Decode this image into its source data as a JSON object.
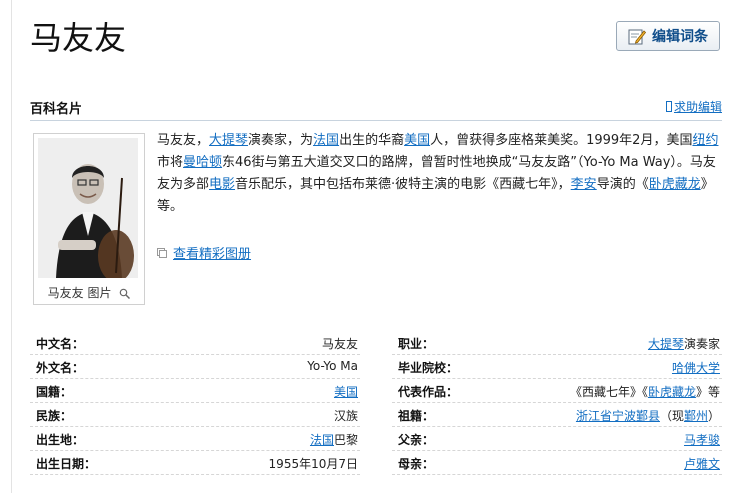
{
  "header": {
    "title": "马友友",
    "edit_button_label": "编辑词条"
  },
  "section": {
    "title": "百科名片",
    "help_edit": "求助编辑"
  },
  "card": {
    "photo_caption": "马友友 图片",
    "gallery_link": "查看精彩图册",
    "summary": [
      {
        "text": "马友友，"
      },
      {
        "text": "大提琴",
        "link": true
      },
      {
        "text": "演奏家，为"
      },
      {
        "text": "法国",
        "link": true
      },
      {
        "text": "出生的华裔"
      },
      {
        "text": "美国",
        "link": true
      },
      {
        "text": "人，曾获得多座格莱美奖。1999年2月，美国"
      },
      {
        "text": "纽约",
        "link": true
      },
      {
        "text": "市将"
      },
      {
        "text": "曼哈顿",
        "link": true
      },
      {
        "text": "东46街与第五大道交叉口的路牌，曾暂时性地换成“马友友路”（Yo-Yo Ma Way）。马友友为多部"
      },
      {
        "text": "电影",
        "link": true
      },
      {
        "text": "音乐配乐，其中包括布莱德·彼特主演的电影《西藏七年》，"
      },
      {
        "text": "李安",
        "link": true
      },
      {
        "text": "导演的《"
      },
      {
        "text": "卧虎藏龙",
        "link": true
      },
      {
        "text": "》等。"
      }
    ]
  },
  "info_left": [
    {
      "label": "中文名：",
      "parts": [
        {
          "text": "马友友"
        }
      ]
    },
    {
      "label": "外文名：",
      "parts": [
        {
          "text": "Yo-Yo Ma"
        }
      ]
    },
    {
      "label": "国籍：",
      "parts": [
        {
          "text": "美国",
          "link": true
        }
      ]
    },
    {
      "label": "民族：",
      "parts": [
        {
          "text": "汉族"
        }
      ]
    },
    {
      "label": "出生地：",
      "parts": [
        {
          "text": "法国",
          "link": true
        },
        {
          "text": "巴黎"
        }
      ]
    },
    {
      "label": "出生日期：",
      "parts": [
        {
          "text": "1955年10月7日"
        }
      ]
    }
  ],
  "info_right": [
    {
      "label": "职业：",
      "parts": [
        {
          "text": "大提琴",
          "link": true
        },
        {
          "text": "演奏家"
        }
      ]
    },
    {
      "label": "毕业院校：",
      "parts": [
        {
          "text": "哈佛大学",
          "link": true
        }
      ]
    },
    {
      "label": "代表作品：",
      "parts": [
        {
          "text": "《西藏七年》《"
        },
        {
          "text": "卧虎藏龙",
          "link": true
        },
        {
          "text": "》等"
        }
      ]
    },
    {
      "label": "祖籍：",
      "parts": [
        {
          "text": "浙江省宁波鄞县",
          "link": true
        },
        {
          "text": "（现"
        },
        {
          "text": "鄞州",
          "link": true
        },
        {
          "text": "）"
        }
      ]
    },
    {
      "label": "父亲：",
      "parts": [
        {
          "text": "马孝骏",
          "link": true
        }
      ]
    },
    {
      "label": "母亲：",
      "parts": [
        {
          "text": "卢雅文",
          "link": true
        }
      ]
    }
  ],
  "colors": {
    "link": "#136ec2",
    "border": "#c8d3de"
  },
  "icons": [
    "edit-icon",
    "pencil-icon",
    "gallery-icon",
    "zoom-icon"
  ]
}
